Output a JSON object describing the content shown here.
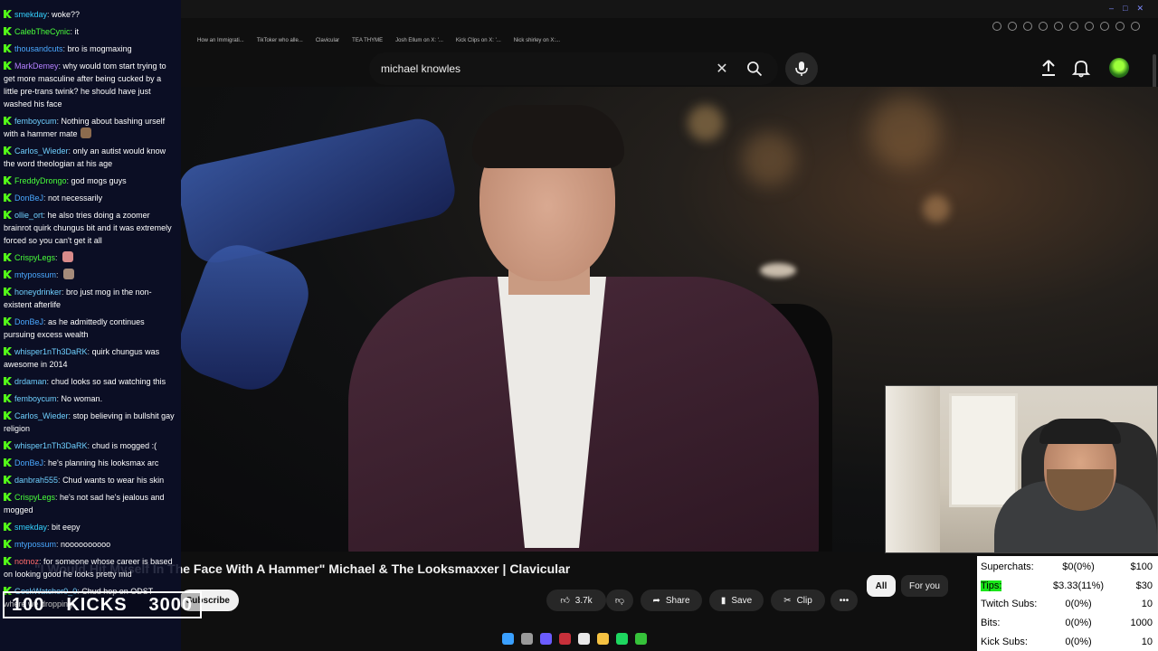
{
  "browser": {
    "bookmarks": [
      "How an Immigrati...",
      "TikToker who alle...",
      "Clavicular",
      "TEA THYME",
      "Josh Ellum on X: '...",
      "Kick Clips on X: '...",
      "Nick shirley on X:..."
    ],
    "window_controls": [
      "–",
      "□",
      "✕"
    ]
  },
  "youtube": {
    "search_value": "michael knowles",
    "video_title": "\"I Would Hit Myself In The Face With A Hammer\" Michael & The Looksmaxxer | Clavicular",
    "subscribe_label": "Subscribe",
    "like_count": "3.7k",
    "share_label": "Share",
    "save_label": "Save",
    "clip_label": "Clip",
    "more_label": "•••",
    "tabs": [
      "All",
      "For you"
    ]
  },
  "chat": {
    "messages": [
      {
        "user": "smekday",
        "color": "#34d1ff",
        "text": "woke??"
      },
      {
        "user": "CalebTheCynic",
        "color": "#49ff3a",
        "text": "it"
      },
      {
        "user": "thousandcuts",
        "color": "#4aa8ff",
        "text": "bro is mogmaxing"
      },
      {
        "user": "MarkDemey",
        "color": "#b480ff",
        "text": "why would tom start trying to get more masculine after being cucked by a little pre-trans twink? he should have just washed his face"
      },
      {
        "user": "femboycum",
        "color": "#6fd0ff",
        "text": "Nothing about bashing urself with a hammer mate",
        "emote": "#8c6b4e"
      },
      {
        "user": "Carlos_Wieder",
        "color": "#6fd0ff",
        "text": "only an autist would know the word theologian at his age"
      },
      {
        "user": "FreddyDrongo",
        "color": "#49ff3a",
        "text": "god mogs guys"
      },
      {
        "user": "DonBeJ",
        "color": "#4aa8ff",
        "text": "not necessarily"
      },
      {
        "user": "ollie_ort",
        "color": "#6fd0ff",
        "text": "he also tries doing a zoomer brainrot quirk chungus bit and it was extremely forced so you can't get it all"
      },
      {
        "user": "CrispyLegs",
        "color": "#49ff3a",
        "text": "",
        "emote": "#d98a8a"
      },
      {
        "user": "mtypossum",
        "color": "#4aa8ff",
        "text": "",
        "emote": "#a58b7a"
      },
      {
        "user": "honeydrinker",
        "color": "#6fd0ff",
        "text": "bro just mog in the non-existent afterlife"
      },
      {
        "user": "DonBeJ",
        "color": "#4aa8ff",
        "text": "as he admittedly continues pursuing excess wealth"
      },
      {
        "user": "whisper1nTh3DaRK",
        "color": "#6fd0ff",
        "text": "quirk chungus was awesome in 2014"
      },
      {
        "user": "drdaman",
        "color": "#6fd0ff",
        "text": "chud looks so sad watching this"
      },
      {
        "user": "femboycum",
        "color": "#6fd0ff",
        "text": "No woman."
      },
      {
        "user": "Carlos_Wieder",
        "color": "#6fd0ff",
        "text": "stop believing in bullshit gay religion"
      },
      {
        "user": "whisper1nTh3DaRK",
        "color": "#6fd0ff",
        "text": "chud is mogged :("
      },
      {
        "user": "DonBeJ",
        "color": "#4aa8ff",
        "text": "he's planning his looksmax arc"
      },
      {
        "user": "danbrah555",
        "color": "#6fd0ff",
        "text": "Chud wants to wear his skin"
      },
      {
        "user": "CrispyLegs",
        "color": "#49ff3a",
        "text": "he's not sad he's jealous and mogged"
      },
      {
        "user": "smekday",
        "color": "#34d1ff",
        "text": "bit eepy"
      },
      {
        "user": "mtypossum",
        "color": "#4aa8ff",
        "text": "noooooooooo"
      },
      {
        "user": "notnoz",
        "color": "#ff6b6b",
        "text": "for someone whose career is based on looking good he looks pretty mid"
      },
      {
        "user": "GockWatcher0_0",
        "color": "#6fd0ff",
        "text": "Chud hop on ODST where we dropping"
      }
    ]
  },
  "kicks_goal": {
    "current": "100",
    "label": "KICKS",
    "target": "3000"
  },
  "stats": {
    "rows": [
      {
        "label": "Superchats:",
        "value": "$0(0%)",
        "goal": "$100",
        "highlight": false
      },
      {
        "label": "Tips:",
        "value": "$3.33(11%)",
        "goal": "$30",
        "highlight": true
      },
      {
        "label": "Twitch Subs:",
        "value": "0(0%)",
        "goal": "10",
        "highlight": false
      },
      {
        "label": "Bits:",
        "value": "0(0%)",
        "goal": "1000",
        "highlight": false
      },
      {
        "label": "Kick Subs:",
        "value": "0(0%)",
        "goal": "10",
        "highlight": false
      }
    ],
    "highlight_color": "#19e619"
  }
}
